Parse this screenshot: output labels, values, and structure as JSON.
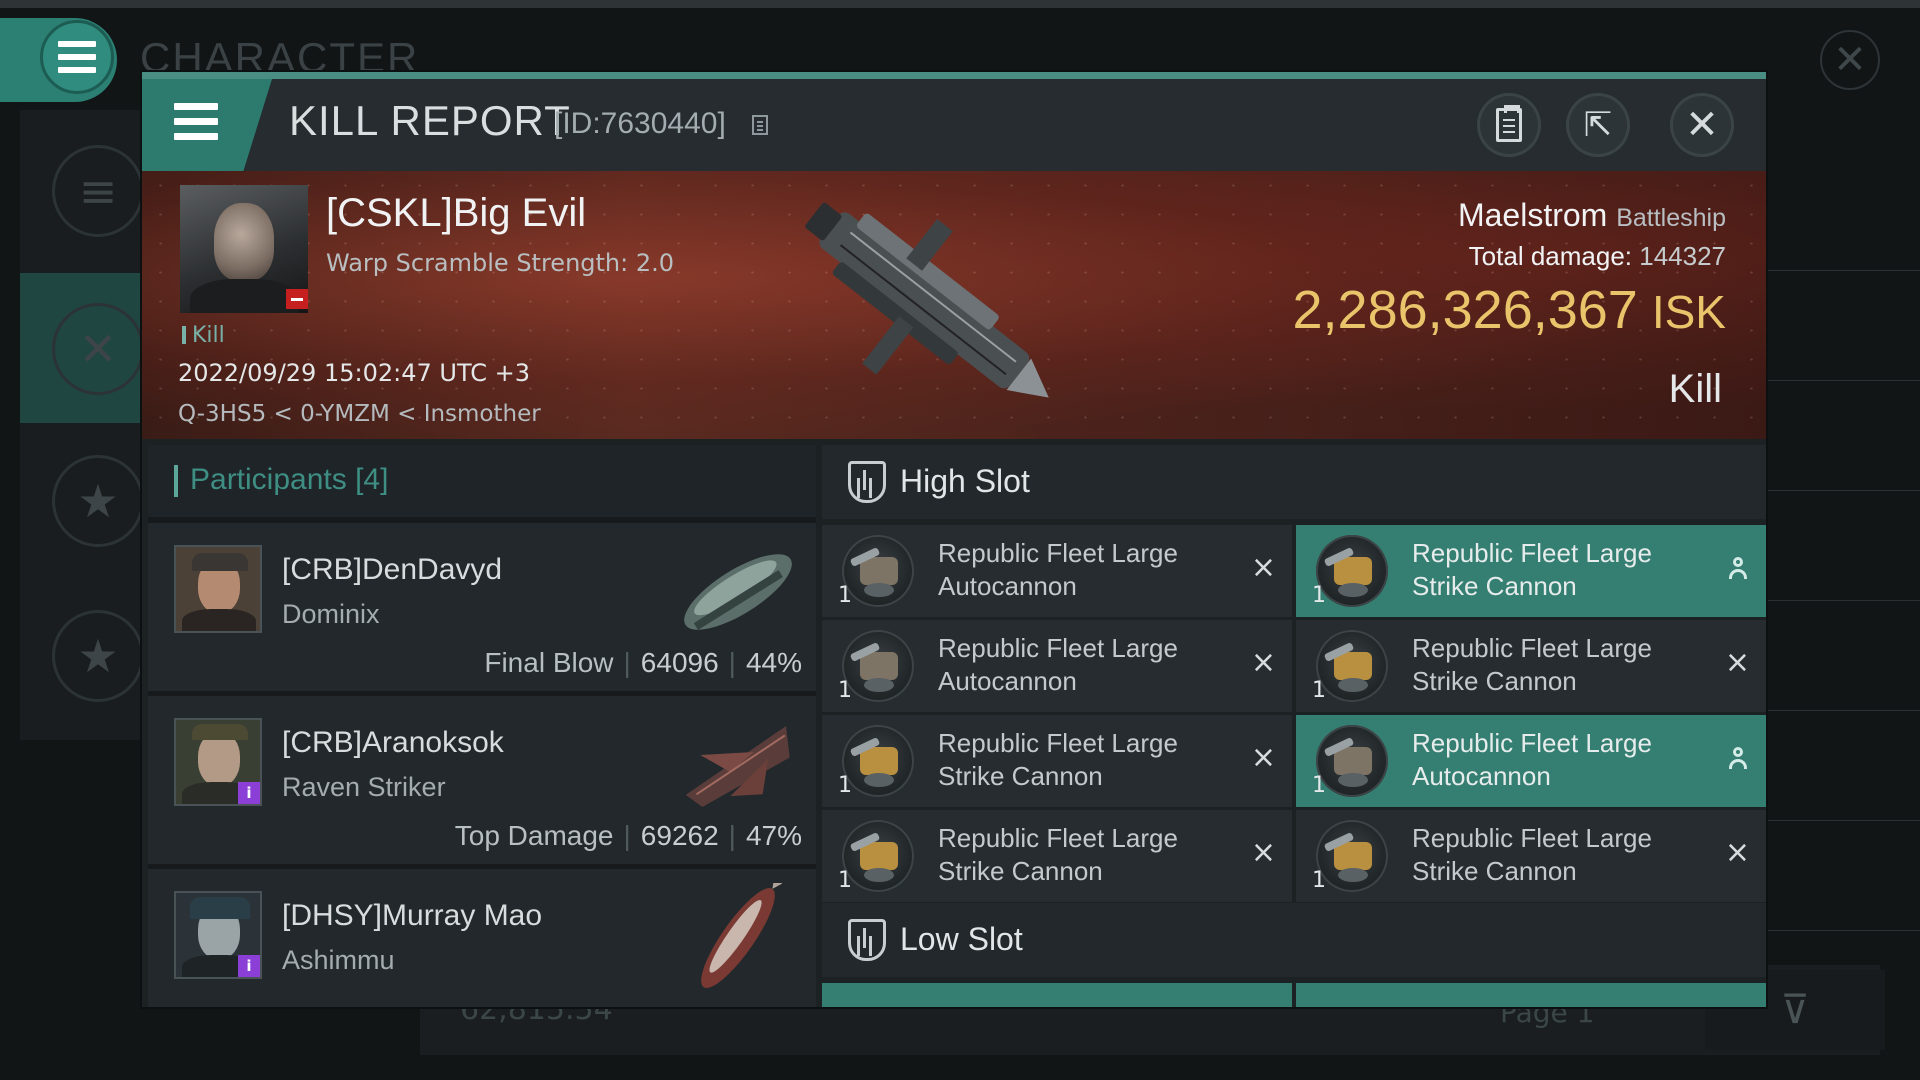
{
  "background": {
    "title": "CHARACTER",
    "bottom_value": "62,815.54",
    "bottom_page": "Page 1"
  },
  "header": {
    "title": "KILL REPORT",
    "id": "[ID:7630440]"
  },
  "victim": {
    "name": "[CSKL]Big Evil",
    "subtitle": "Warp Scramble Strength: 2.0",
    "tag": "Kill",
    "datetime": "2022/09/29 15:02:47 UTC +3",
    "location": "Q-3HS5 < 0-YMZM < Insmother",
    "ship": "Maelstrom",
    "ship_class": "Battleship",
    "damage_label": "Total damage:",
    "total_damage": "144327",
    "isk_value": "2,286,326,367",
    "isk_unit": "ISK",
    "result": "Kill"
  },
  "participants": {
    "title": "Participants [4]",
    "rows": [
      {
        "name": "[CRB]DenDavyd",
        "ship": "Dominix",
        "role": "Final Blow",
        "damage": "64096",
        "percent": "44%"
      },
      {
        "name": "[CRB]Aranoksok",
        "ship": "Raven Striker",
        "role": "Top Damage",
        "damage": "69262",
        "percent": "47%"
      },
      {
        "name": "[DHSY]Murray Mao",
        "ship": "Ashimmu"
      }
    ]
  },
  "high_slot": {
    "title": "High Slot",
    "modules": [
      {
        "qty": "1",
        "name": "Republic Fleet Large Autocannon",
        "status": "destroyed"
      },
      {
        "qty": "1",
        "name": "Republic Fleet Large Strike Cannon",
        "status": "dropped"
      },
      {
        "qty": "1",
        "name": "Republic Fleet Large Autocannon",
        "status": "destroyed"
      },
      {
        "qty": "1",
        "name": "Republic Fleet Large Strike Cannon",
        "status": "destroyed"
      },
      {
        "qty": "1",
        "name": "Republic Fleet Large Strike Cannon",
        "status": "destroyed"
      },
      {
        "qty": "1",
        "name": "Republic Fleet Large Autocannon",
        "status": "dropped"
      },
      {
        "qty": "1",
        "name": "Republic Fleet Large Strike Cannon",
        "status": "destroyed"
      },
      {
        "qty": "1",
        "name": "Republic Fleet Large Strike Cannon",
        "status": "destroyed"
      }
    ]
  },
  "low_slot": {
    "title": "Low Slot"
  },
  "icons": {
    "status_destroyed": "×",
    "external": "⇱",
    "close": "✕"
  },
  "colors": {
    "accent": "#2d7a6f",
    "isk": "#e9c46a",
    "dropped_bg": "#357e72"
  }
}
